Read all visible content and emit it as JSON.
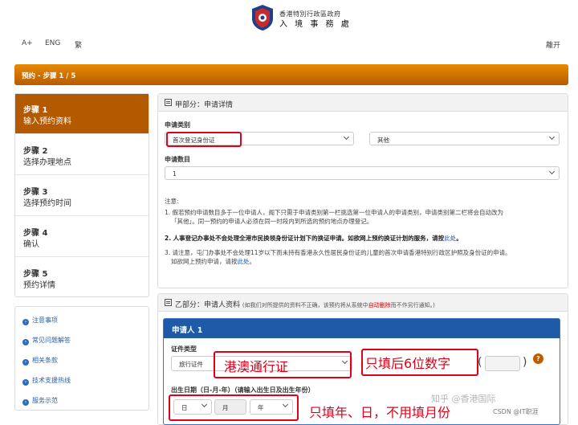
{
  "header": {
    "logo_line1": "香港特別行政區政府",
    "logo_line2": "入 境 事 務 處",
    "nav": {
      "font_size": "A+",
      "eng": "ENG",
      "trad": "繁",
      "logout": "離开"
    }
  },
  "progress": {
    "label": "预约 - 步骤 1 / 5"
  },
  "steps": [
    {
      "num": "步骤 1",
      "title": "输入预约资料"
    },
    {
      "num": "步骤 2",
      "title": "选择办理地点"
    },
    {
      "num": "步骤 3",
      "title": "选择预约时间"
    },
    {
      "num": "步骤 4",
      "title": "确认"
    },
    {
      "num": "步骤 5",
      "title": "预约详情"
    }
  ],
  "links": [
    "注意事项",
    "常见问题解答",
    "相关条款",
    "技术支援热线",
    "服务示范"
  ],
  "partA": {
    "title": "甲部分：申请详情",
    "category_label": "申请类别",
    "category_value": "首次登记身份证",
    "category2_value": "其他",
    "count_label": "申请数目",
    "count_value": "1",
    "note_title": "注意:",
    "note1_a": "1. 假若预约申请数目多于一位申请人，阁下只需于申请类别第一栏挑选第一位申请人的申请类别，申请类别第二栏将会自动改为",
    "note1_b": "「其他」。同一预约的申请人必须在同一时段内到所选的预约地点办理登记。",
    "note2_a": "2. 人事登记办事处不会处理全港市民换领身份证计划下的换证申请。如欲网上预约换证计划的服务，请按",
    "note2_link": "此处",
    "note2_end": "。",
    "note3_a": "3. 请注意，屯门办事处不会处理11岁以下而未持有香港永久性居民身份证的儿童的首次申请香港特别行政区护照及身份证的申请。",
    "note3_b": "如欲网上预约申请，请按",
    "note3_link": "此处",
    "note3_end": "。"
  },
  "partB": {
    "title": "乙部分：申请人资料",
    "sub_a": "(如我们对所提供的资料不正确，该预约将从系统中",
    "sub_red": "自动删除",
    "sub_b": "而不作另行通知。)",
    "applicant": "申请人 1",
    "doc_label": "证件类型",
    "doc_value": "旅行证件",
    "doc_hint": "港澳通行证",
    "digits_hint": "只填后6位数字",
    "paren_open": "(",
    "paren_close": ")",
    "dob_label": "出生日期（日-月-年）（请输入出生日及出生年份）",
    "day": "日",
    "month": "月",
    "year": "年",
    "dob_hint": "只填年、日，不用填月份",
    "help": "?"
  },
  "watermark": "知乎 @香港国际",
  "csdn": "CSDN @IT职涯"
}
